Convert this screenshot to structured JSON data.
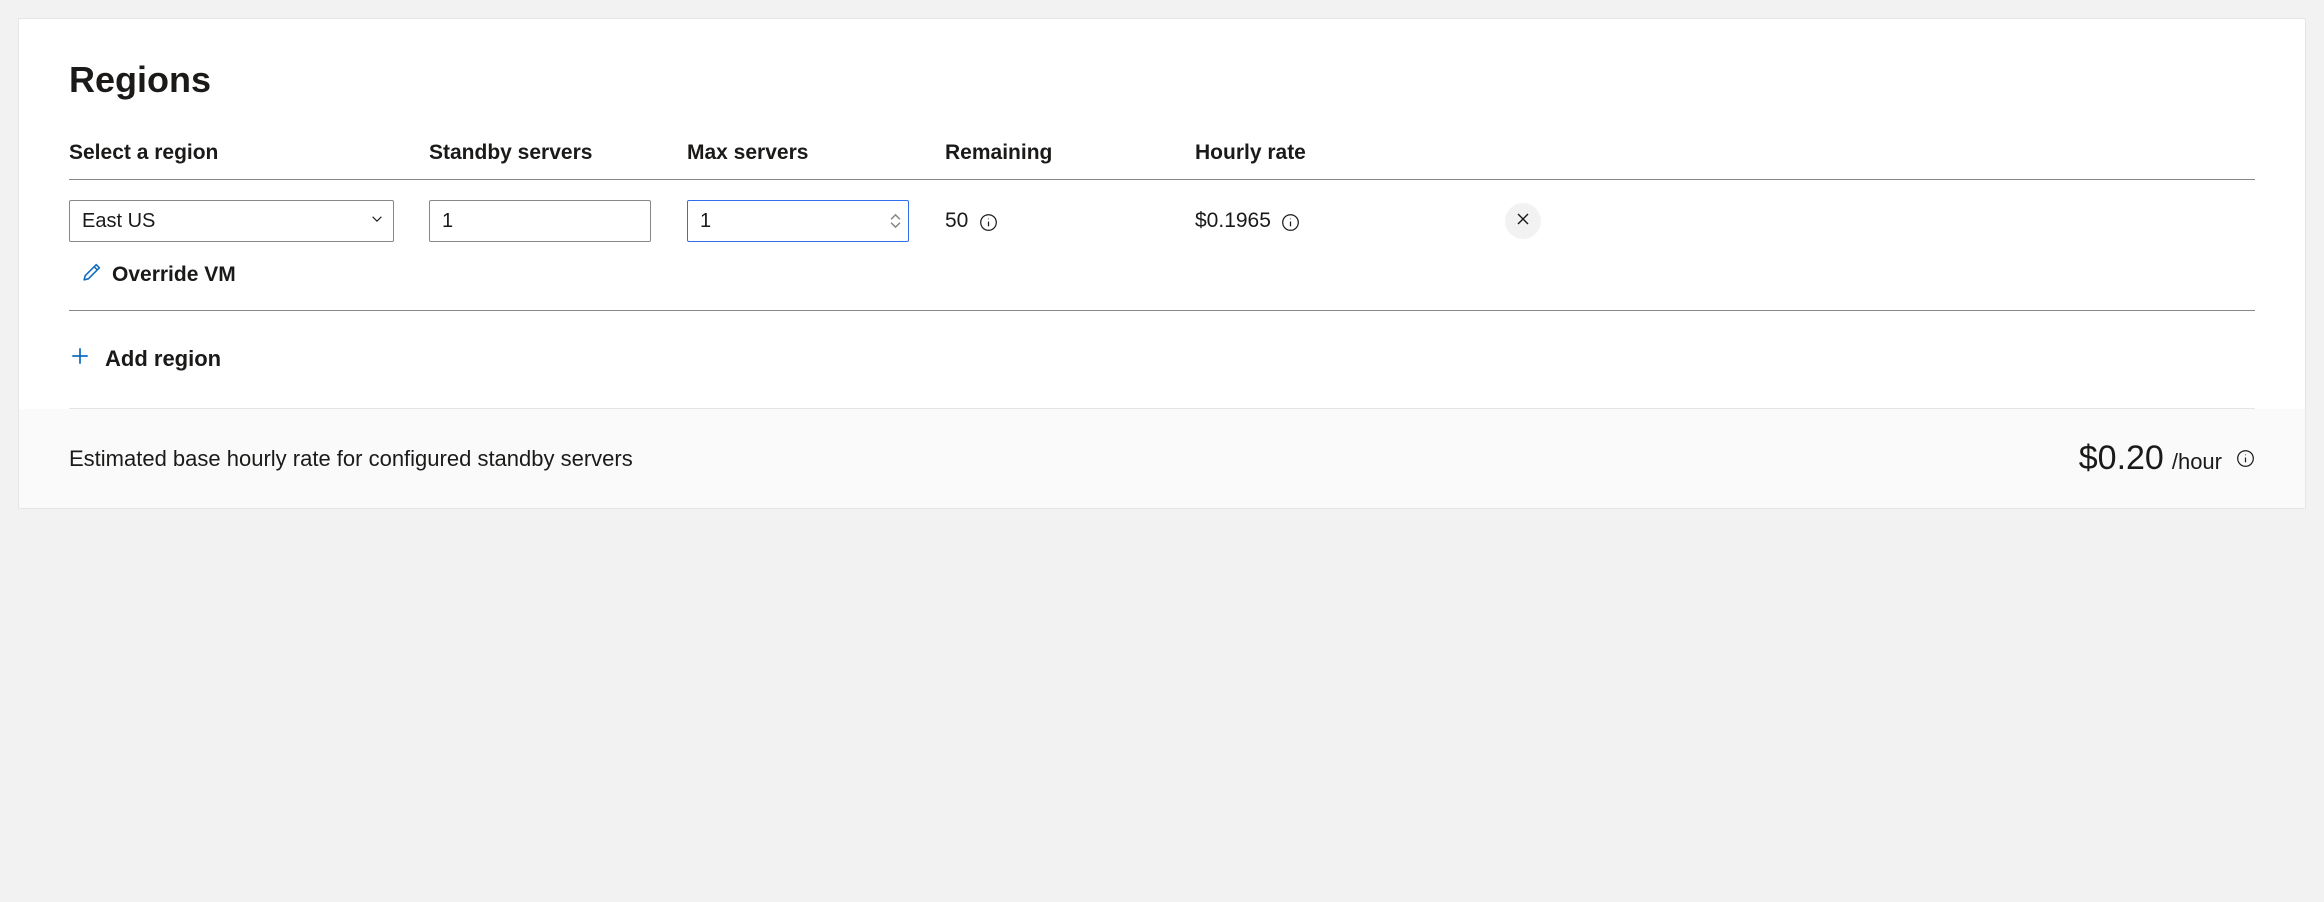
{
  "title": "Regions",
  "headers": {
    "region": "Select a region",
    "standby": "Standby servers",
    "max": "Max servers",
    "remaining": "Remaining",
    "rate": "Hourly rate"
  },
  "row": {
    "region_selected": "East US",
    "standby_value": "1",
    "max_value": "1",
    "remaining": "50",
    "hourly_rate": "$0.1965"
  },
  "override_label": "Override VM",
  "add_region_label": "Add region",
  "footer": {
    "text": "Estimated base hourly rate for configured standby servers",
    "amount": "$0.20",
    "suffix": "/hour"
  },
  "colors": {
    "accent": "#0f6cbd"
  }
}
